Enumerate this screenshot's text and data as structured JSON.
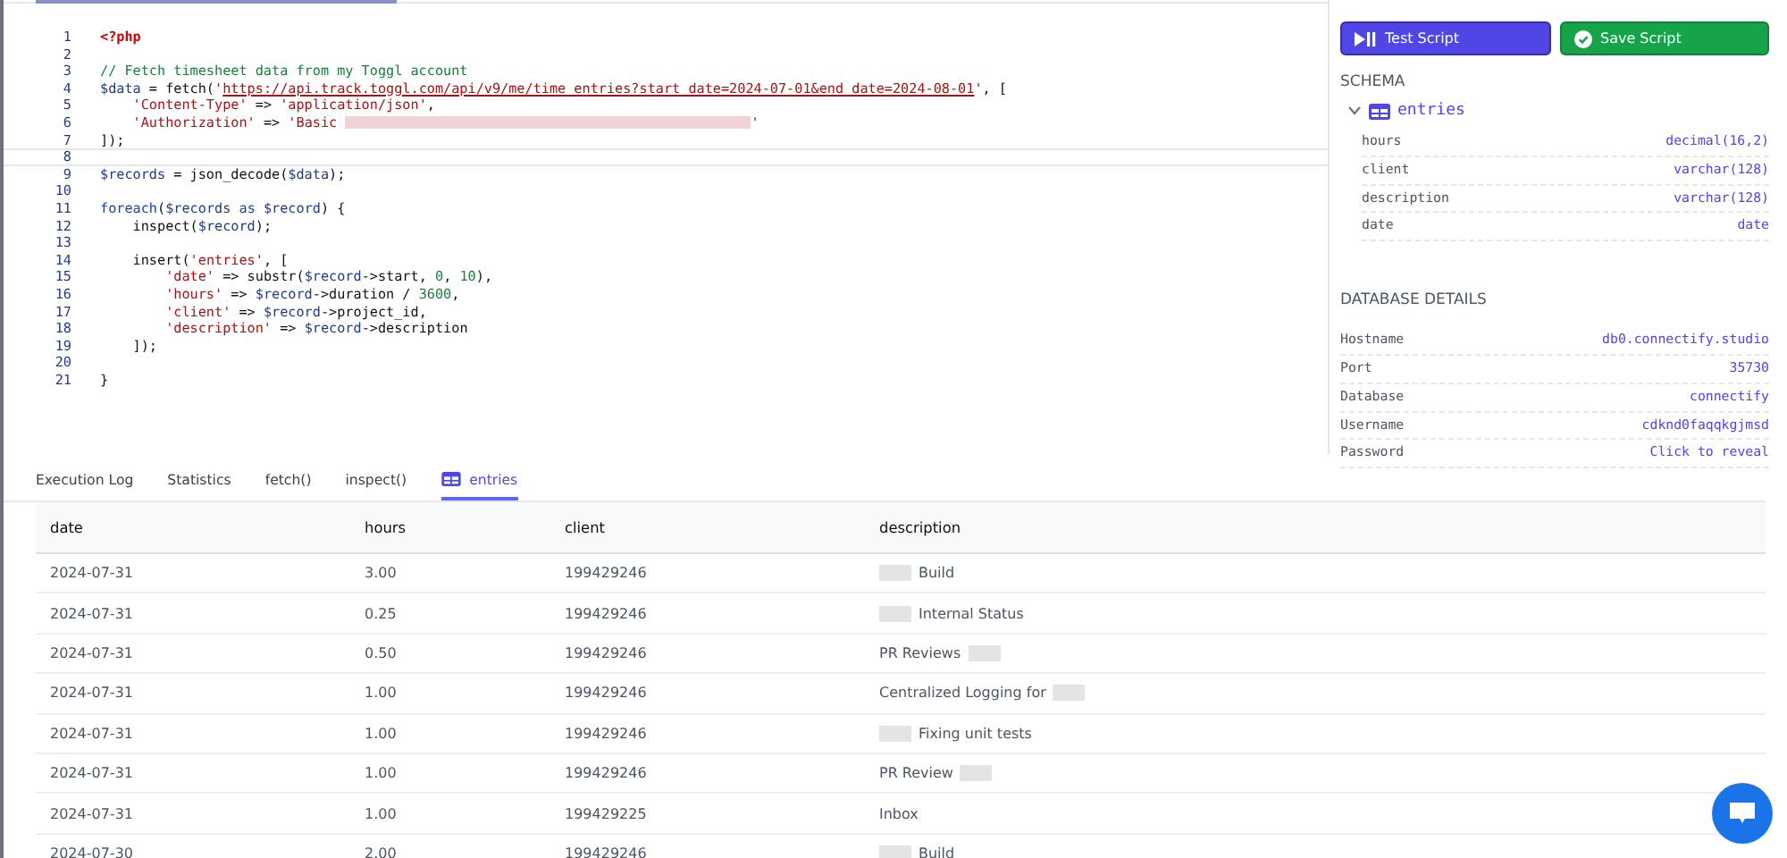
{
  "editor": {
    "lines": [
      {
        "number": "1",
        "tokens": [
          {
            "kind": "keyword",
            "text": "<?php"
          }
        ]
      },
      {
        "number": "2"
      },
      {
        "number": "3",
        "tokens": [
          {
            "kind": "comment",
            "text": "// Fetch timesheet data from my Toggl account"
          }
        ]
      },
      {
        "number": "4",
        "tokens": [
          {
            "kind": "var",
            "text": "$data"
          },
          {
            "kind": "plain",
            "text": " = fetch("
          },
          {
            "kind": "string",
            "text": "'"
          },
          {
            "kind": "url",
            "text": "https://api.track.toggl.com/api/v9/me/time_entries?start_date=2024-07-01&end_date=2024-08-01"
          },
          {
            "kind": "string",
            "text": "'"
          },
          {
            "kind": "plain",
            "text": ", ["
          }
        ]
      },
      {
        "number": "5",
        "tokens": [
          {
            "kind": "string",
            "text": "    'Content-Type'"
          },
          {
            "kind": "plain",
            "text": " => "
          },
          {
            "kind": "string",
            "text": "'application/json'"
          },
          {
            "kind": "plain",
            "text": ","
          }
        ]
      },
      {
        "number": "6",
        "tokens": [
          {
            "kind": "string",
            "text": "    'Authorization'"
          },
          {
            "kind": "plain",
            "text": " => "
          },
          {
            "kind": "string",
            "text": "'Basic "
          },
          {
            "kind": "redacted"
          },
          {
            "kind": "string",
            "text": "'"
          }
        ]
      },
      {
        "number": "7",
        "tokens": [
          {
            "kind": "plain",
            "text": "]);"
          }
        ]
      },
      {
        "number": "8",
        "current": true
      },
      {
        "number": "9",
        "tokens": [
          {
            "kind": "var",
            "text": "$records"
          },
          {
            "kind": "plain",
            "text": " = json_decode("
          },
          {
            "kind": "var",
            "text": "$data"
          },
          {
            "kind": "plain",
            "text": ");"
          }
        ]
      },
      {
        "number": "10"
      },
      {
        "number": "11",
        "tokens": [
          {
            "kind": "keyword2",
            "text": "foreach"
          },
          {
            "kind": "plain",
            "text": "("
          },
          {
            "kind": "var",
            "text": "$records"
          },
          {
            "kind": "keyword2",
            "text": " as "
          },
          {
            "kind": "var",
            "text": "$record"
          },
          {
            "kind": "plain",
            "text": ") {"
          }
        ]
      },
      {
        "number": "12",
        "tokens": [
          {
            "kind": "plain",
            "text": "    inspect("
          },
          {
            "kind": "var",
            "text": "$record"
          },
          {
            "kind": "plain",
            "text": ");"
          }
        ]
      },
      {
        "number": "13"
      },
      {
        "number": "14",
        "tokens": [
          {
            "kind": "plain",
            "text": "    insert("
          },
          {
            "kind": "string",
            "text": "'entries'"
          },
          {
            "kind": "plain",
            "text": ", ["
          }
        ]
      },
      {
        "number": "15",
        "tokens": [
          {
            "kind": "string",
            "text": "        'date'"
          },
          {
            "kind": "plain",
            "text": " => substr("
          },
          {
            "kind": "var",
            "text": "$record"
          },
          {
            "kind": "plain",
            "text": "->start, "
          },
          {
            "kind": "number",
            "text": "0"
          },
          {
            "kind": "plain",
            "text": ", "
          },
          {
            "kind": "number",
            "text": "10"
          },
          {
            "kind": "plain",
            "text": "),"
          }
        ]
      },
      {
        "number": "16",
        "tokens": [
          {
            "kind": "string",
            "text": "        'hours'"
          },
          {
            "kind": "plain",
            "text": " => "
          },
          {
            "kind": "var",
            "text": "$record"
          },
          {
            "kind": "plain",
            "text": "->duration / "
          },
          {
            "kind": "number",
            "text": "3600"
          },
          {
            "kind": "plain",
            "text": ","
          }
        ]
      },
      {
        "number": "17",
        "tokens": [
          {
            "kind": "string",
            "text": "        'client'"
          },
          {
            "kind": "plain",
            "text": " => "
          },
          {
            "kind": "var",
            "text": "$record"
          },
          {
            "kind": "plain",
            "text": "->project_id,"
          }
        ]
      },
      {
        "number": "18",
        "tokens": [
          {
            "kind": "string",
            "text": "        'description'"
          },
          {
            "kind": "plain",
            "text": " => "
          },
          {
            "kind": "var",
            "text": "$record"
          },
          {
            "kind": "plain",
            "text": "->description"
          }
        ]
      },
      {
        "number": "19",
        "tokens": [
          {
            "kind": "plain",
            "text": "    ]);"
          }
        ]
      },
      {
        "number": "20"
      },
      {
        "number": "21",
        "tokens": [
          {
            "kind": "plain",
            "text": "}"
          }
        ]
      }
    ]
  },
  "buttons": [
    {
      "label": "Test Script",
      "kind": "test"
    },
    {
      "label": "Save Script",
      "kind": "save"
    }
  ],
  "schema": {
    "heading": "SCHEMA",
    "table": {
      "name": "entries",
      "expanded": true,
      "fields": [
        {
          "name": "hours",
          "type": "decimal(16,2)"
        },
        {
          "name": "client",
          "type": "varchar(128)"
        },
        {
          "name": "description",
          "type": "varchar(128)"
        },
        {
          "name": "date",
          "type": "date"
        }
      ]
    }
  },
  "database_details": {
    "heading": "DATABASE DETAILS",
    "rows": [
      {
        "label": "Hostname",
        "value": "db0.connectify.studio"
      },
      {
        "label": "Port",
        "value": "35730"
      },
      {
        "label": "Database",
        "value": "connectify"
      },
      {
        "label": "Username",
        "value": "cdknd0faqqkgjmsd"
      },
      {
        "label": "Password",
        "value": "Click to reveal"
      }
    ]
  },
  "result_tabs": [
    {
      "label": "Execution Log",
      "selected": false,
      "kind": "text"
    },
    {
      "label": "Statistics",
      "selected": false,
      "kind": "text"
    },
    {
      "label": "fetch()",
      "selected": false,
      "kind": "text"
    },
    {
      "label": "inspect()",
      "selected": false,
      "kind": "text"
    },
    {
      "label": "entries",
      "selected": true,
      "kind": "table"
    }
  ],
  "table": {
    "columns": [
      "date",
      "hours",
      "client",
      "description"
    ],
    "rows": [
      {
        "date": "2024-07-31",
        "hours": "3.00",
        "client": "199429246",
        "description": "Build",
        "redacted_before": true
      },
      {
        "date": "2024-07-31",
        "hours": "0.25",
        "client": "199429246",
        "description": "Internal Status",
        "redacted_before": true
      },
      {
        "date": "2024-07-31",
        "hours": "0.50",
        "client": "199429246",
        "description": "PR Reviews",
        "redacted_after": true
      },
      {
        "date": "2024-07-31",
        "hours": "1.00",
        "client": "199429246",
        "description": "Centralized Logging for",
        "redacted_after": true
      },
      {
        "date": "2024-07-31",
        "hours": "1.00",
        "client": "199429246",
        "description": "Fixing unit tests",
        "redacted_before": true
      },
      {
        "date": "2024-07-31",
        "hours": "1.00",
        "client": "199429246",
        "description": "PR Review",
        "redacted_after": true
      },
      {
        "date": "2024-07-31",
        "hours": "1.00",
        "client": "199429225",
        "description": "Inbox"
      },
      {
        "date": "2024-07-30",
        "hours": "2.00",
        "client": "199429246",
        "description": "Build",
        "redacted_before": true
      }
    ]
  }
}
